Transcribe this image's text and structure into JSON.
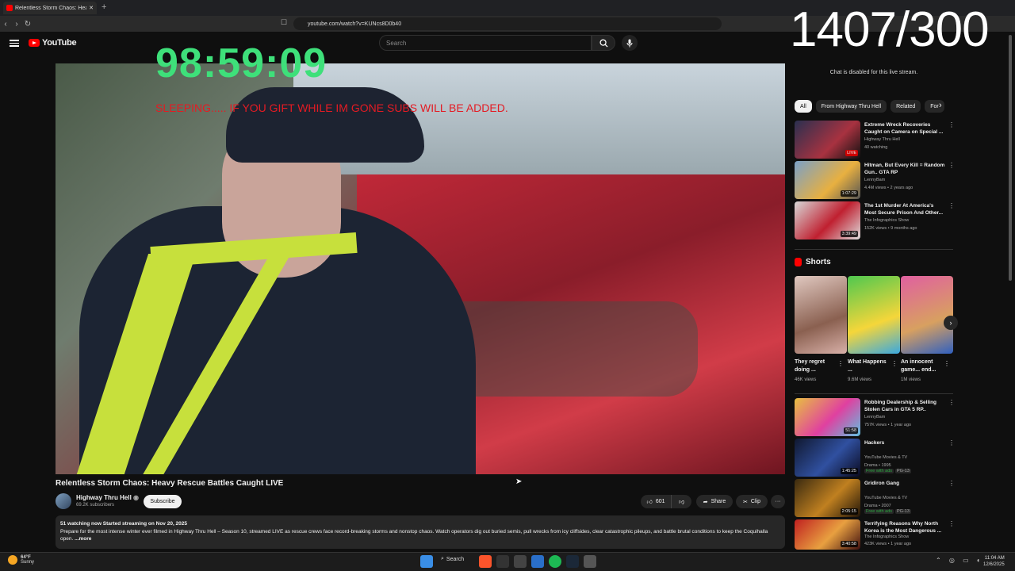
{
  "browser": {
    "tab_title": "Relentless Storm Chaos: Heav",
    "new_tab": "+",
    "url": "youtube.com/watch?v=KUNcs8D0b40"
  },
  "overlay": {
    "counter": "1407/300",
    "timer": "98:59:09",
    "sleep_msg": "SLEEPING.....   IF YOU GIFT WHILE IM GONE SUBS WILL BE ADDED."
  },
  "header": {
    "logo": "YouTube",
    "search_placeholder": "Search"
  },
  "video": {
    "title": "Relentless Storm Chaos: Heavy Rescue Battles Caught LIVE",
    "channel": "Highway Thru Hell",
    "subscribers": "69.2K subscribers",
    "subscribe_label": "Subscribe",
    "likes": "601",
    "share_label": "Share",
    "clip_label": "Clip",
    "more_label": "···",
    "desc_stats": "51 watching now  Started streaming on Nov 20, 2025",
    "desc_text": "Prepare for the most intense winter ever filmed in Highway Thru Hell – Season 10, streamed LIVE as rescue crews face record-breaking storms and nonstop chaos. Watch operators dig out buried semis, pull wrecks from icy cliffsides, clear catastrophic pileups, and battle brutal conditions to keep the Coquihalla open.",
    "desc_more": "...more"
  },
  "sidebar": {
    "chat_disabled": "Chat is disabled for this live stream.",
    "chips": [
      "All",
      "From Highway Thru Hell",
      "Related",
      "For"
    ],
    "recs": [
      {
        "title": "Extreme Wreck Recoveries Caught on Camera on Special ...",
        "channel": "Highway Thru Hell",
        "meta": "40 watching",
        "badge": "LIVE"
      },
      {
        "title": "Hitman, But Every Kill = Random Gun.. GTA RP",
        "channel": "LennyBam",
        "meta": "4.4M views • 2 years ago",
        "badge": "1:07:29"
      },
      {
        "title": "The 1st Murder At America's Most Secure Prison And Other...",
        "channel": "The Infographics Show",
        "meta": "152K views • 9 months ago",
        "badge": "3:39:49"
      }
    ],
    "shorts_heading": "Shorts",
    "shorts": [
      {
        "title": "They regret doing ...",
        "views": "46K views"
      },
      {
        "title": "What Happens ...",
        "views": "9.6M views"
      },
      {
        "title": "An innocent game... end...",
        "views": "1M views"
      }
    ],
    "recs2": [
      {
        "title": "Robbing Dealership & Selling Stolen Cars in GTA 5 RP..",
        "channel": "LennyBam",
        "meta": "757K views • 1 year ago",
        "badge": "51:58"
      },
      {
        "title": "Hackers",
        "channel": "YouTube Movies & TV",
        "meta": "Drama • 1995",
        "tag": "Free with ads",
        "rating": "PG-13",
        "badge": "1:45:25"
      },
      {
        "title": "Gridiron Gang",
        "channel": "YouTube Movies & TV",
        "meta": "Drama • 2007",
        "tag": "Free with ads",
        "rating": "PG-13",
        "badge": "2:05:15"
      },
      {
        "title": "Terrifying Reasons Why North Korea is the Most Dangerous ...",
        "channel": "The Infographics Show",
        "meta": "423K views • 1 year ago",
        "badge": "3:40:58"
      }
    ]
  },
  "taskbar": {
    "temp": "64°F",
    "weather": "Sunny",
    "search_label": "Search",
    "time": "11:04 AM",
    "date": "12/6/2025"
  }
}
